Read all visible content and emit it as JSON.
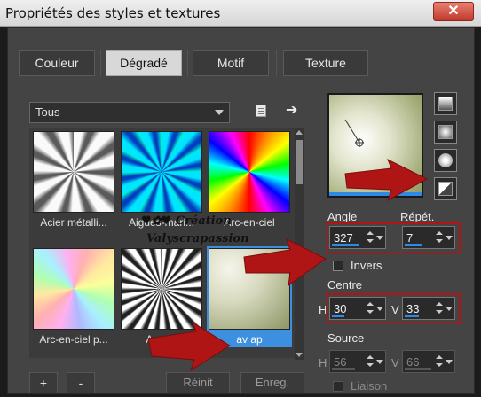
{
  "window": {
    "title": "Propriétés des styles et textures",
    "close_glyph": "✕"
  },
  "tabs": [
    {
      "label": "Couleur",
      "active": false
    },
    {
      "label": "Dégradé",
      "active": true
    },
    {
      "label": "Motif",
      "active": false
    },
    {
      "label": "Texture",
      "active": false
    }
  ],
  "filter": {
    "value": "Tous"
  },
  "gradients": [
    {
      "label": "Acier métalli...",
      "selected": false
    },
    {
      "label": "Aigues-mari...",
      "selected": false
    },
    {
      "label": "Arc-en-ciel",
      "selected": false
    },
    {
      "label": "Arc-en-ciel p...",
      "selected": false
    },
    {
      "label": "Argent",
      "selected": false
    },
    {
      "label": "av ap",
      "selected": true
    }
  ],
  "watermark": {
    "line1": "♥✿♥ Création",
    "line2": "Valyscrapassion"
  },
  "params": {
    "angle_label": "Angle",
    "angle_value": "327",
    "repeat_label": "Répét.",
    "repeat_value": "7",
    "invert_label": "Invers",
    "center_label": "Centre",
    "h_label": "H",
    "v_label": "V",
    "center_h": "30",
    "center_v": "33",
    "source_label": "Source",
    "source_h": "56",
    "source_v": "66",
    "link_label": "Liaison"
  },
  "buttons": {
    "add": "+",
    "remove": "-",
    "reset": "Réinit",
    "save": "Enreg."
  },
  "colors": {
    "accent": "#2f8ae6",
    "highlight": "#b01515",
    "gradient_light": "#f3f3e6",
    "gradient_dark": "#8c9564"
  }
}
